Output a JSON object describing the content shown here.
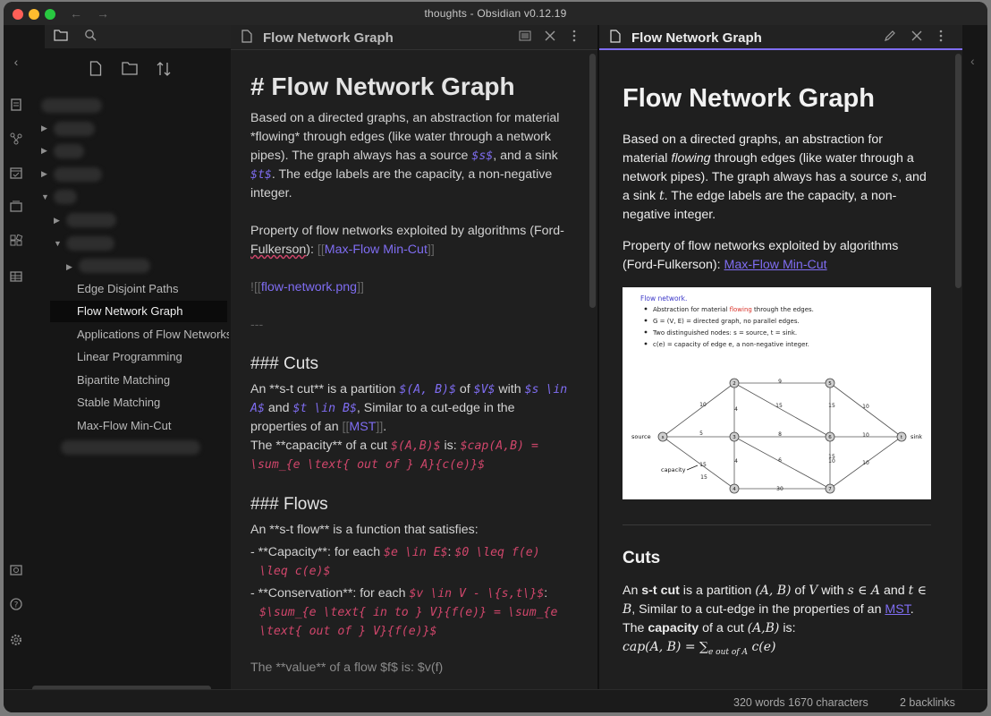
{
  "window": {
    "title": "thoughts - Obsidian v0.12.19"
  },
  "colors": {
    "accent": "#7f6df2",
    "math": "#d0466b",
    "close": "#ff5f57",
    "minimize": "#febc2e",
    "zoom": "#28c840"
  },
  "ribbon": {
    "icons": [
      "collapse-left-icon",
      "file-explorer-icon",
      "graph-view-icon",
      "daily-note-icon",
      "slides-icon",
      "plugins-icon",
      "table-icon",
      "vault-icon",
      "help-icon",
      "settings-icon"
    ]
  },
  "sidebar": {
    "tab_icons": [
      "folder-icon",
      "search-icon"
    ],
    "action_icons": [
      "new-note-icon",
      "new-folder-icon",
      "sort-icon"
    ],
    "files": [
      {
        "label": "Edge Disjoint Paths"
      },
      {
        "label": "Flow Network Graph"
      },
      {
        "label": "Applications of Flow Networks"
      },
      {
        "label": "Linear Programming"
      },
      {
        "label": "Bipartite Matching"
      },
      {
        "label": "Stable Matching"
      },
      {
        "label": "Max-Flow Min-Cut"
      }
    ]
  },
  "editor": {
    "tab_title": "Flow Network Graph",
    "h1": "# Flow Network Graph",
    "p1": {
      "a": "Based on a directed graphs, an abstraction for material *flowing* through edges (like water through a network pipes). The graph always has a source ",
      "m1": "$s$",
      "b": ", and a sink ",
      "m2": "$t$",
      "c": ". The edge labels are the capacity, a non-negative integer."
    },
    "p2": {
      "a": "Property of flow networks exploited by algorithms (Ford-",
      "spell": "Fulkerson",
      "b": "):  ",
      "open": "[[",
      "link": "Max-Flow Min-Cut",
      "close": "]]"
    },
    "p3": {
      "open": "![[",
      "link": "flow-network.png",
      "close": "]]"
    },
    "hr": "---",
    "h3_cuts": "### Cuts",
    "cuts": {
      "a": "An **s-t cut** is a partition ",
      "m1": "$(A, B)$",
      "b": " of ",
      "m2": "$V$",
      "c": " with ",
      "m3": "$s \\in A$",
      "d": " and ",
      "m4": "$t \\in B$",
      "e": ", Similar to a cut-edge in the properties of an ",
      "open": "[[",
      "link": "MST",
      "close": "]]",
      "f": ".",
      "g": "The **capacity** of a cut ",
      "m5": "$(A,B)$",
      "h": " is: ",
      "m6": "$cap(A,B) = \\sum_{e \\text{ out of } A}{c(e)}$"
    },
    "h3_flows": "### Flows",
    "flows_intro": "An **s-t flow** is a function that satisfies:",
    "cap_item": {
      "a": "- **Capacity**: for each ",
      "m1": "$e \\in E$",
      "b": ": ",
      "m2": "$0 \\leq f(e) \\leq c(e)$"
    },
    "cons_item": {
      "a": "- **Conservation**: for each ",
      "m1": "$v \\in V - \\{s,t\\}$",
      "b": ": ",
      "m2": "$\\sum_{e \\text{ in to } V}{f(e)} = \\sum_{e \\text{ out of } V}{f(e)}$"
    },
    "cutoff_line": "The **value** of a flow $f$ is: $v(f)"
  },
  "preview": {
    "tab_title": "Flow Network Graph",
    "h1": "Flow Network Graph",
    "p1": {
      "a": "Based on a directed graphs, an abstraction for material ",
      "em": "flowing",
      "b": " through edges (like water through a network pipes). The graph always has a source ",
      "s": "s",
      "c": ", and a sink ",
      "t": "t",
      "d": ". The edge labels are the capacity, a non-negative integer."
    },
    "p2": {
      "a": "Property of flow networks exploited by algorithms (Ford-Fulkerson): ",
      "link": "Max-Flow Min-Cut"
    },
    "figure": {
      "heading": "Flow network.",
      "bullets": [
        {
          "a": "Abstraction for material ",
          "hl": "flowing",
          "b": " through the edges."
        },
        {
          "a": "G = (V, E) = directed graph, no parallel edges.",
          "hl": "",
          "b": ""
        },
        {
          "a": "Two distinguished nodes:  s = source, t = sink.",
          "hl": "",
          "b": ""
        },
        {
          "a": "c(e) = capacity of edge e, a non-negative integer.",
          "hl": "",
          "b": ""
        }
      ],
      "nodes": [
        "s",
        "2",
        "3",
        "4",
        "5",
        "6",
        "7",
        "t"
      ],
      "edge_labels": [
        "9",
        "10",
        "5",
        "15",
        "4",
        "15",
        "4",
        "8",
        "15",
        "6",
        "10",
        "15",
        "30",
        "10",
        "10",
        "10",
        "15"
      ],
      "source_label": "source",
      "sink_label": "sink",
      "capacity_label": "capacity"
    },
    "h2_cuts": "Cuts",
    "cuts": {
      "a": "An ",
      "bold": "s-t cut",
      "b": " is a partition ",
      "m1": "(A, B)",
      "c": " of ",
      "m2": "V",
      "d": " with ",
      "m3": "s ∈ A",
      "e": " and ",
      "m4": "t ∈ B",
      "f": ", Similar to a cut-edge in the properties of an ",
      "link": "MST",
      "g": ".",
      "h": "The ",
      "bold2": "capacity",
      "i": " of a cut ",
      "m5": "(A,B)",
      "j": " is:",
      "formula_a": "cap(A, B) = ∑",
      "formula_sub": "e out of A",
      "formula_b": " c(e)"
    }
  },
  "status": {
    "words": "320 words 1670 characters",
    "backlinks": "2 backlinks"
  }
}
